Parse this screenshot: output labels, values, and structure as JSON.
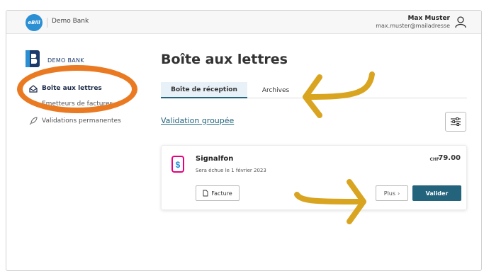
{
  "topbar": {
    "logo_text": "eBill",
    "bank_name": "Demo Bank",
    "user_name": "Max Muster",
    "user_email": "max.muster@mailadresse"
  },
  "sidebar": {
    "bank_logo_text": "DEMO BANK",
    "items": [
      {
        "label": "Boîte aux lettres",
        "active": true
      },
      {
        "label": "Emetteurs de factures",
        "active": false
      },
      {
        "label": "Validations permanentes",
        "active": false
      }
    ]
  },
  "main": {
    "title": "Boîte aux lettres",
    "tabs": [
      {
        "label": "Boîte de réception",
        "active": true
      },
      {
        "label": "Archives",
        "active": false
      }
    ],
    "bulk_link": "Validation groupée"
  },
  "bill": {
    "sender": "Signalfon",
    "due_text": "Sera échue le 1 février 2023",
    "currency": "CHF",
    "amount": "79.00",
    "invoice_button": "Facture",
    "more_button": "Plus",
    "validate_button": "Valider"
  },
  "colors": {
    "accent": "#23637c",
    "ebill_blue": "#2b8fd4",
    "annotation_orange": "#ea7a22",
    "annotation_gold": "#d9a520",
    "sender_pink": "#e6007e"
  }
}
